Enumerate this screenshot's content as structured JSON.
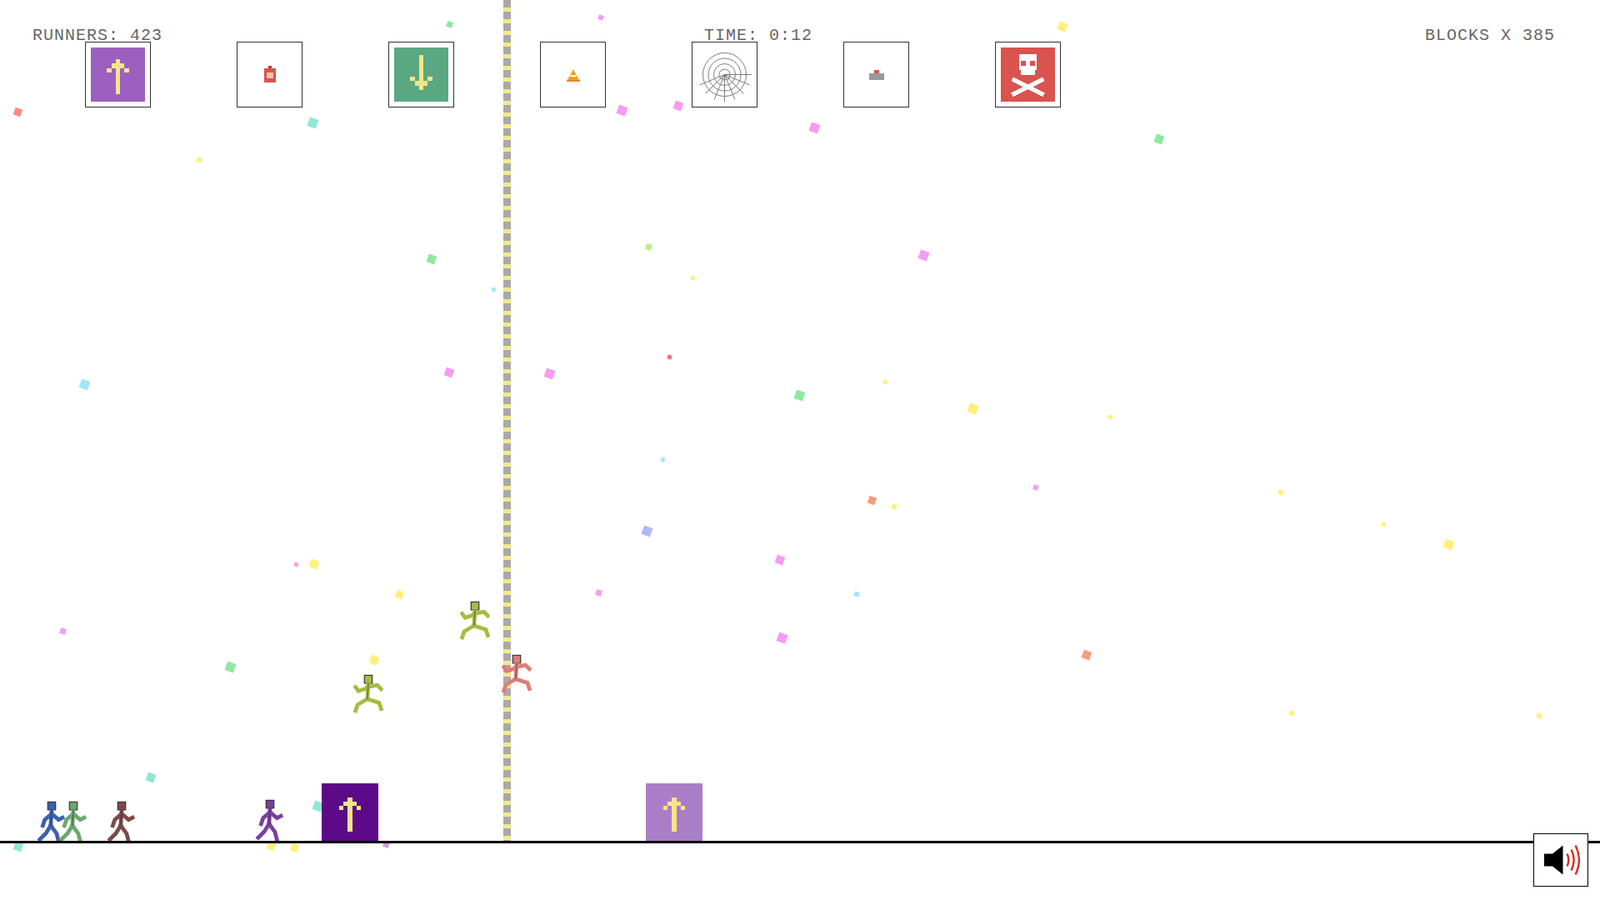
{
  "hud": {
    "runners": "RUNNERS: 423",
    "time": "TIME: 0:12",
    "blocks": "BLOCKS X 385"
  },
  "toolbar": [
    {
      "kind": "boost-up"
    },
    {
      "kind": "dynamite"
    },
    {
      "kind": "boost-down"
    },
    {
      "kind": "cone"
    },
    {
      "kind": "web"
    },
    {
      "kind": "button"
    },
    {
      "kind": "skull"
    }
  ],
  "ground_blocks": [
    {
      "kind": "boost-up",
      "ghost": false
    },
    {
      "kind": "boost-up",
      "ghost": true
    }
  ],
  "runners": [
    {
      "color": "#3c5fb0",
      "airborne": false
    },
    {
      "color": "#6aa86a",
      "airborne": false
    },
    {
      "color": "#7a4a4a",
      "airborne": false
    },
    {
      "color": "#7a3fa0",
      "airborne": false
    },
    {
      "color": "#a8bb40",
      "airborne": true
    },
    {
      "color": "#a8bb40",
      "airborne": true
    },
    {
      "color": "#e07c7c",
      "airborne": true
    }
  ],
  "sound": {
    "muted": false
  }
}
